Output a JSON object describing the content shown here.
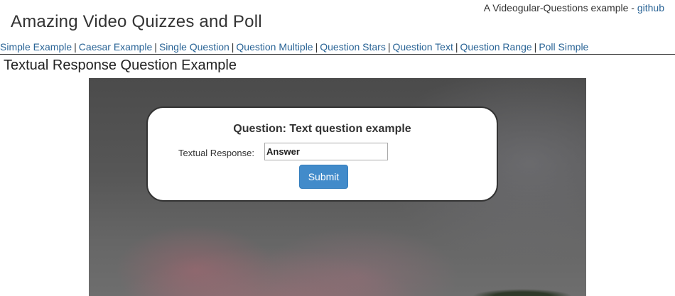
{
  "header": {
    "tagline": "A Videogular-Questions example - ",
    "tagline_link": "github",
    "title": "Amazing Video Quizzes and Poll"
  },
  "nav": {
    "items": [
      {
        "label": "Simple Example"
      },
      {
        "label": "Caesar Example"
      },
      {
        "label": "Single Question"
      },
      {
        "label": "Question Multiple"
      },
      {
        "label": "Question Stars"
      },
      {
        "label": "Question Text"
      },
      {
        "label": "Question Range"
      },
      {
        "label": "Poll Simple"
      }
    ],
    "separator": "|"
  },
  "section": {
    "title": "Textual Response Question Example"
  },
  "question": {
    "title": "Question: Text question example",
    "response_label": "Textual Response:",
    "response_value": "Answer",
    "submit_label": "Submit"
  },
  "colors": {
    "link": "#2a6496",
    "button": "#428bca"
  }
}
